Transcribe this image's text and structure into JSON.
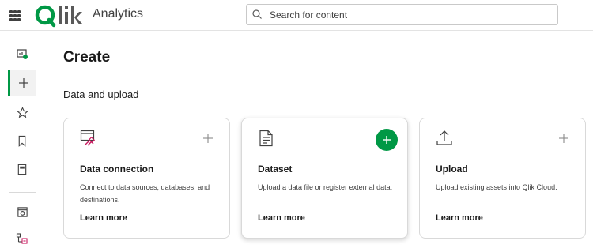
{
  "header": {
    "brand": "Qlik",
    "app_name": "Analytics",
    "search": {
      "placeholder": "Search for content",
      "value": ""
    }
  },
  "sidebar": {
    "items": [
      {
        "icon": "home-icon",
        "label": "Home"
      },
      {
        "icon": "plus-icon",
        "label": "Create",
        "active": true
      },
      {
        "icon": "star-icon",
        "label": "Favorites"
      },
      {
        "icon": "bookmark-icon",
        "label": "Collections"
      },
      {
        "icon": "catalog-icon",
        "label": "Catalog"
      },
      {
        "icon": "analytics-icon",
        "label": "Analytics"
      },
      {
        "icon": "data-flow-icon",
        "label": "Data"
      }
    ]
  },
  "main": {
    "title": "Create",
    "section": "Data and upload",
    "cards": [
      {
        "icon": "data-connection-icon",
        "title": "Data connection",
        "description": "Connect to data sources, databases, and destinations.",
        "link": "Learn more"
      },
      {
        "icon": "dataset-icon",
        "title": "Dataset",
        "description": "Upload a data file or register external data.",
        "link": "Learn more"
      },
      {
        "icon": "upload-icon",
        "title": "Upload",
        "description": "Upload existing assets into Qlik Cloud.",
        "link": "Learn more"
      }
    ]
  },
  "colors": {
    "accent": "#009845",
    "text": "#1a1a1a",
    "muted": "#404040",
    "border": "#d9d9d9"
  }
}
